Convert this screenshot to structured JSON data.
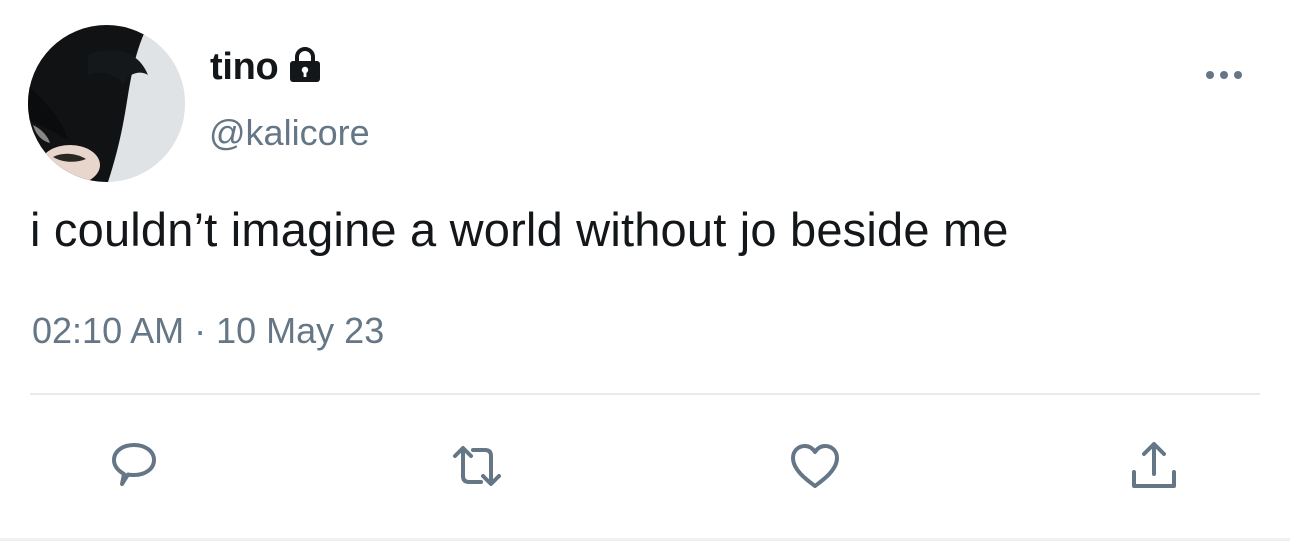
{
  "tweet": {
    "display_name": "tino",
    "handle": "@kalicore",
    "text": "i couldn’t imagine a world without jo beside me",
    "time": "02:10 AM",
    "separator": "·",
    "date": "10 May 23"
  },
  "icons": {
    "protected": "lock-icon",
    "more": "more-icon",
    "reply": "reply-icon",
    "retweet": "retweet-icon",
    "like": "like-icon",
    "share": "share-icon"
  },
  "colors": {
    "text": "#14171a",
    "secondary": "#657786",
    "divider": "#e6ecf0"
  }
}
